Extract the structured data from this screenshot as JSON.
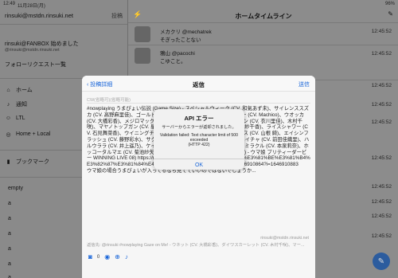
{
  "status": {
    "time": "12:49",
    "date": "11月28日(月)",
    "battery": "96%"
  },
  "sidebar": {
    "account": "rinsuki@mstdn.rinsuki.net",
    "post_label": "投稿",
    "profile_name": "rinsuki@FANBOX 始めました",
    "profile_handle": "@rinsuki@mstdn.rinsuki.net",
    "follow_requests": "フォローリクエスト一覧",
    "nav": [
      {
        "label": "ホーム",
        "icon": "house-icon"
      },
      {
        "label": "通知",
        "icon": "bell-icon"
      },
      {
        "label": "LTL",
        "icon": "people-icon"
      },
      {
        "label": "Home + Local",
        "icon": "globe-icon"
      }
    ],
    "bookmark": "ブックマーク",
    "lists": [
      "empty",
      "a",
      "a",
      "a",
      "a",
      "a",
      "a"
    ]
  },
  "main": {
    "title": "ホームタイムライン",
    "rows": [
      {
        "name": "メカクリ @mechatrek",
        "text": "そぎったことない",
        "time": "12:45:52"
      },
      {
        "name": "鴉山 @pacochi",
        "text": "こゆこと。",
        "time": "12:45:52"
      },
      {
        "name": "",
        "text": "",
        "time": "12:45:52"
      },
      {
        "name": "",
        "text": "",
        "time": "12:45:52"
      },
      {
        "name": "",
        "text": "",
        "time": "12:45:52"
      },
      {
        "name": "",
        "text": "",
        "time": "12:45:52"
      },
      {
        "name": "",
        "text": "",
        "time": "12:45:52"
      },
      {
        "name": "",
        "text": "",
        "time": "12:45:52"
      },
      {
        "name": "",
        "text": "",
        "time": "12:45:52"
      },
      {
        "name": "",
        "text": "",
        "time": "12:45:52"
      }
    ]
  },
  "sheet": {
    "back": "投稿詳細",
    "title": "返信",
    "send": "送信",
    "cw_placeholder": "CW(省略可)(省略可能)",
    "body": "#nowplaying うまぴょい伝説 (Game Size) - スペシャルウィーク (CV. 和氣あず未)、サイレンススズカ (CV. 高野麻里佳)、ゴールドシップ (CV. 上田 瞳)、トウカイテイオー (CV. Machico)、ウオッカ (CV. 大橋彩香)、メジロマックイーン (CV. 大西沙織)、ナリタブライアン (CV. 衣川里佳)、木村千咲)、マヤノトップガン (CV. 星谷美緒)、サクラバクシンオー (CV. 三澤紗千香)、ライスシャワー (CV. 石見舞菜香)、ウイニングチケット (CV. 渡部優衣)、ダイタクヘリオス (CV. 山根 綺)、エイシンフラッシュ (CV. 藤野彩水)、サクラローレル (CV. 高野麻里佳)、ナイスネイチャ (CV. 前田佳織里)、ハルウララ (CV. 井上遥乃)、ケイエスミラクル (CV. 井上遥乃)、ケイエスミラクル (CV. 本泉莉奈)、ホッコータルマエ (CV. 菊池紗矢香) & ワンダーアキュート (CV. 今井麻夏) - ウマ娘 プリティーダービー WINNING LIVE 08) https://music.apple.com/jp/album/%E3%81%86%E3%81%BE%E3%81%B4%E3%82%87%E3%81%84%E4%BC%9D%E8%AA%AC-game-size/1646910864?i=1646910883\nウマ娘の場合うまぴょいが入ってるなら見てていいのではないでしょうか...",
    "footer_meta": "返信先: @rinsuki #nowplaying Gaze on Me! - ウネット (CV. 大橋彩香)、ダイワスカーレット (CV. 木村千咲)、マー...",
    "footer_account": "rinsuki@mstdn.rinsuki.net",
    "image_count": "0"
  },
  "alert": {
    "title": "API エラー",
    "subtitle": "サーバーからエラーが返却されました。",
    "message": "Validation failed: Text character limit of 500 exceeded\n(HTTP 422)",
    "ok": "OK"
  }
}
